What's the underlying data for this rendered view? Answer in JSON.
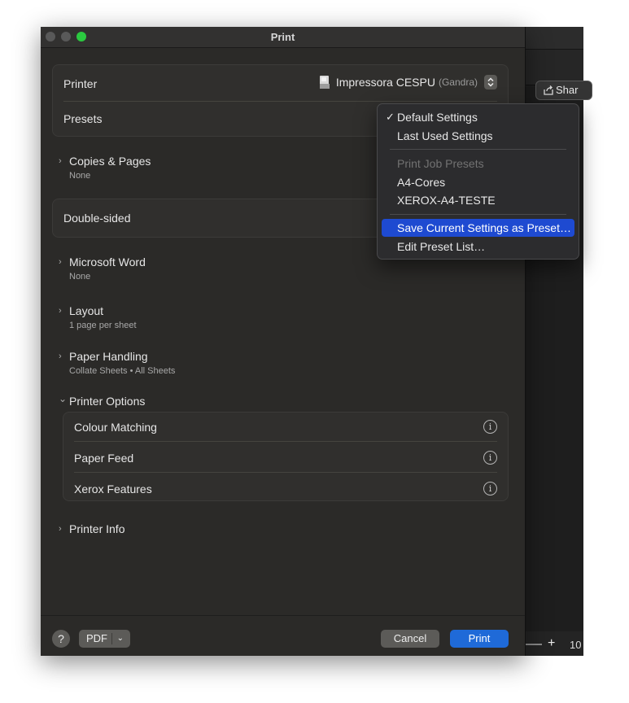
{
  "dialog": {
    "title": "Print",
    "printer": {
      "label": "Printer",
      "name": "Impressora CESPU",
      "location": "(Gandra)"
    },
    "presets": {
      "label": "Presets"
    },
    "copies_pages": {
      "title": "Copies & Pages",
      "subtitle": "None"
    },
    "double_sided": {
      "label": "Double-sided"
    },
    "microsoft_word": {
      "title": "Microsoft Word",
      "subtitle": "None"
    },
    "layout": {
      "title": "Layout",
      "subtitle": "1 page per sheet"
    },
    "paper_handling": {
      "title": "Paper Handling",
      "subtitle": "Collate Sheets • All Sheets"
    },
    "printer_options": {
      "title": "Printer Options",
      "items": [
        "Colour Matching",
        "Paper Feed",
        "Xerox Features"
      ]
    },
    "printer_info": {
      "title": "Printer Info"
    },
    "footer": {
      "help": "?",
      "pdf_label": "PDF",
      "cancel_label": "Cancel",
      "print_label": "Print"
    }
  },
  "presets_menu": {
    "checked_item": "Default Settings",
    "items": {
      "default": "Default Settings",
      "last_used": "Last Used Settings",
      "header": "Print Job Presets",
      "a4_cores": "A4-Cores",
      "xerox": "XEROX-A4-TESTE",
      "save": "Save Current Settings as Preset…",
      "edit": "Edit Preset List…"
    }
  },
  "background_app": {
    "share_label": "Shar",
    "zoom_plus": "+",
    "zoom_value": "10"
  },
  "icons": {
    "chevron_right": "›",
    "chevron_down": "⌄",
    "info": "i",
    "checkmark": "✓"
  },
  "colors": {
    "accent": "#1f6ad8",
    "menu_highlight": "#1e4ad1",
    "dialog_bg": "#2b2a28"
  }
}
